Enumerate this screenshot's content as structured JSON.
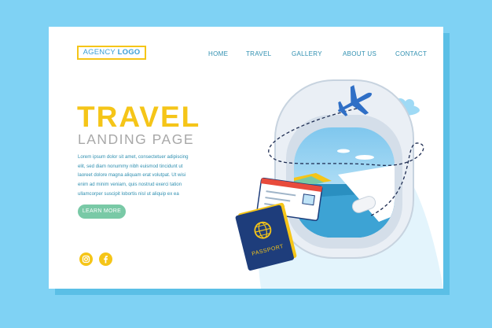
{
  "header": {
    "logo_part1": "AGENCY",
    "logo_part2": "LOGO",
    "nav": [
      "HOME",
      "TRAVEL",
      "GALLERY",
      "ABOUT US",
      "CONTACT"
    ]
  },
  "hero": {
    "title": "TRAVEL",
    "subtitle": "LANDING PAGE",
    "body_lines": [
      "Lorem ipsum dolor sit amet, consectetuer adipiscing",
      "elit, sed diam nonummy nibh euismod tincidunt ut",
      "laoreet dolore magna aliquam erat volutpat. Ut wisi",
      "enim ad minim veniam, quis nostrud exerci tation",
      "ullamcorper suscipit lobortis nisl ut aliquip ex ea"
    ],
    "cta_label": "LEARN MORE"
  },
  "social": [
    "instagram-icon",
    "facebook-icon"
  ],
  "illustration": {
    "passport_label": "PASSPORT"
  },
  "colors": {
    "background": "#7fd2f4",
    "accent_yellow": "#f5c518",
    "nav_blue": "#2f8fb0",
    "button_green": "#79c9a6",
    "plane_blue": "#2f6fc6",
    "passport_navy": "#1e3d7b"
  }
}
